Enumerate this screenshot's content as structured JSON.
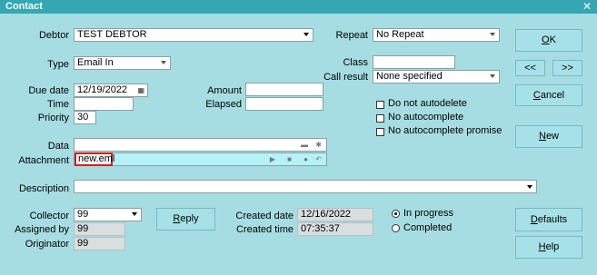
{
  "window": {
    "title": "Contact"
  },
  "debtor": {
    "label": "Debtor",
    "value": "TEST DEBTOR"
  },
  "repeat": {
    "label": "Repeat",
    "value": "No Repeat"
  },
  "type": {
    "label": "Type",
    "value": "Email In"
  },
  "class": {
    "label": "Class",
    "value": ""
  },
  "call_result": {
    "label": "Call result",
    "value": "None specified"
  },
  "due_date": {
    "label": "Due date",
    "value": "12/19/2022"
  },
  "time": {
    "label": "Time",
    "value": ""
  },
  "priority": {
    "label": "Priority",
    "value": "30"
  },
  "amount": {
    "label": "Amount",
    "value": ""
  },
  "elapsed": {
    "label": "Elapsed",
    "value": ""
  },
  "checks": {
    "no_autodelete": "Do not autodelete",
    "no_autocomplete": "No autocomplete",
    "no_autocomplete_promise": "No autocomplete promise"
  },
  "data_field": {
    "label": "Data",
    "value": ""
  },
  "attachment": {
    "label": "Attachment",
    "value": "new.eml"
  },
  "description": {
    "label": "Description",
    "value": ""
  },
  "collector": {
    "label": "Collector",
    "value": "99"
  },
  "assigned_by": {
    "label": "Assigned by",
    "value": "99"
  },
  "originator": {
    "label": "Originator",
    "value": "99"
  },
  "created_date": {
    "label": "Created date",
    "value": "12/16/2022"
  },
  "created_time": {
    "label": "Created time",
    "value": "07:35:37"
  },
  "status": {
    "in_progress": "In progress",
    "completed": "Completed",
    "selected": "in_progress"
  },
  "buttons": {
    "ok_first": "O",
    "ok_rest": "K",
    "prev": "<<",
    "next": ">>",
    "cancel_first": "C",
    "cancel_rest": "ancel",
    "new_first": "N",
    "new_rest": "ew",
    "reply_first": "R",
    "reply_rest": "eply",
    "defaults_first": "D",
    "defaults_rest": "efaults",
    "help_first": "H",
    "help_rest": "elp"
  },
  "colors": {
    "background": "#a6dde2",
    "titlebar": "#35a7b3",
    "attachment_highlight": "#d02020"
  },
  "icons": [
    "calendar-icon",
    "folder-icon",
    "gear-icon",
    "play-icon",
    "stop-icon",
    "record-icon",
    "undo-icon",
    "close-icon",
    "chevron-down-icon"
  ]
}
